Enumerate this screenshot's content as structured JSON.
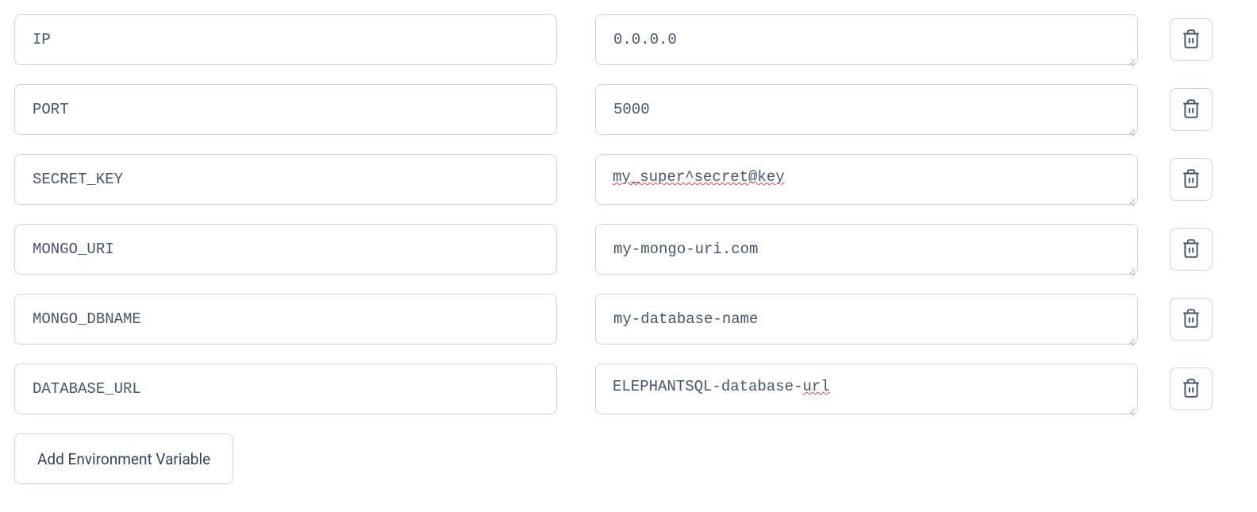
{
  "env_vars": [
    {
      "key": "IP",
      "value": "0.0.0.0",
      "spellcheck_parts": []
    },
    {
      "key": "PORT",
      "value": "5000",
      "spellcheck_parts": []
    },
    {
      "key": "SECRET_KEY",
      "value": "my_super^secret@key",
      "spellcheck_parts": [
        "my_super^secret@key"
      ]
    },
    {
      "key": "MONGO_URI",
      "value": "my-mongo-uri.com",
      "spellcheck_parts": []
    },
    {
      "key": "MONGO_DBNAME",
      "value": "my-database-name",
      "spellcheck_parts": []
    },
    {
      "key": "DATABASE_URL",
      "value": "ELEPHANTSQL-database-url",
      "spellcheck_parts": [
        "url"
      ]
    }
  ],
  "buttons": {
    "add_label": "Add Environment Variable"
  }
}
